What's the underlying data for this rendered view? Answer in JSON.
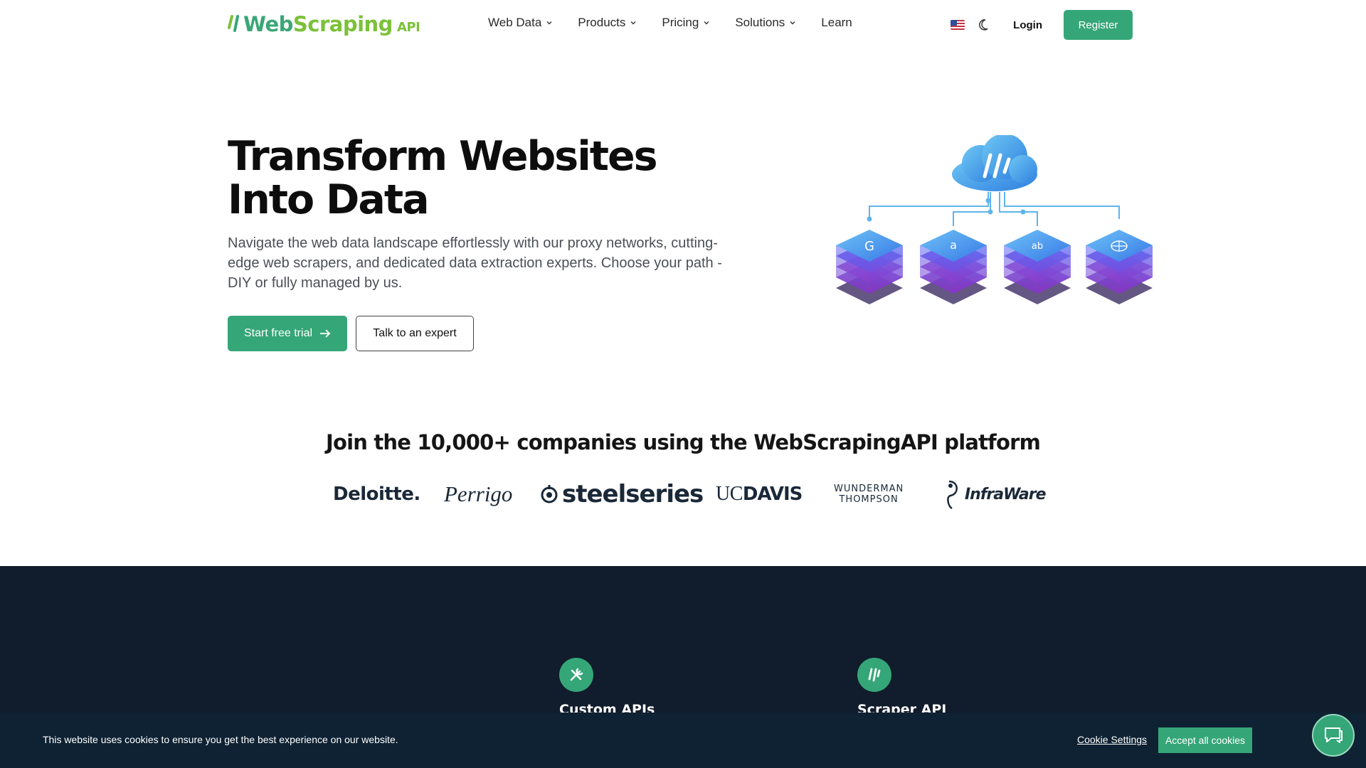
{
  "header": {
    "logo_text_web": "Web",
    "logo_text_scraping": "Scraping",
    "logo_text_api": "API",
    "nav": [
      {
        "label": "Web Data",
        "has_dropdown": true
      },
      {
        "label": "Products",
        "has_dropdown": true
      },
      {
        "label": "Pricing",
        "has_dropdown": true
      },
      {
        "label": "Solutions",
        "has_dropdown": true
      },
      {
        "label": "Learn",
        "has_dropdown": false
      }
    ],
    "login_label": "Login",
    "register_label": "Register"
  },
  "hero": {
    "title_line1": "Transform Websites",
    "title_line2": "Into Data",
    "subtitle": "Navigate the web data landscape effortlessly with our proxy networks, cutting-edge web scrapers, and dedicated data extraction experts. Choose your path - DIY or fully managed by us.",
    "primary_cta": "Start free trial",
    "secondary_cta": "Talk to an expert",
    "illustration_icons": [
      "G",
      "a",
      "ab",
      "globe"
    ]
  },
  "companies": {
    "title": "Join the 10,000+ companies using the WebScrapingAPI platform",
    "logos": [
      "Deloitte.",
      "Perrigo",
      "steelseries",
      "UCDAVIS",
      "WUNDERMAN THOMPSON",
      "InfraWare"
    ],
    "uc": "UC",
    "davis": "DAVIS",
    "wunderman_line1": "WUNDERMAN",
    "wunderman_line2": "THOMPSON"
  },
  "features": [
    {
      "title": "Custom APIs",
      "icon": "tools-icon"
    },
    {
      "title": "Scraper API",
      "icon": "scraper-icon"
    }
  ],
  "cookie": {
    "message": "This website uses cookies to ensure you get the best experience on our website.",
    "settings_label": "Cookie Settings",
    "accept_label": "Accept all cookies"
  },
  "colors": {
    "brand_green": "#35a677",
    "logo_lime": "#7cc13a",
    "dark_section": "#111c2c",
    "cookie_bar": "#0e2233"
  }
}
